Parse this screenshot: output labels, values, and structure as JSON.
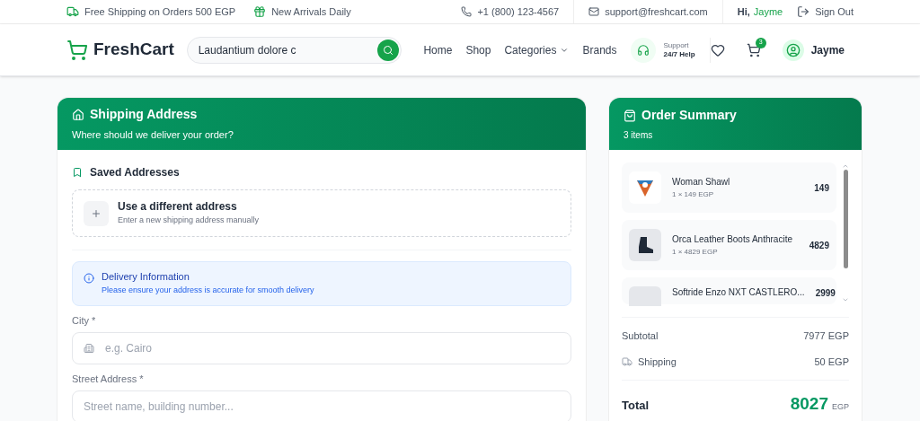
{
  "top_bar": {
    "promos": [
      {
        "kind": "shipping",
        "text": "Free Shipping on Orders 500 EGP"
      },
      {
        "kind": "gift",
        "text": "New Arrivals Daily"
      }
    ],
    "phone": "+1 (800) 123-4567",
    "email": "support@freshcart.com",
    "greeting": "Hi,",
    "user": "Jayme",
    "sign_out": "Sign Out"
  },
  "header": {
    "logo": "FreshCart",
    "search": {
      "value": "Laudantium dolore c"
    },
    "nav": [
      {
        "label": "Home",
        "dropdown": false
      },
      {
        "label": "Shop",
        "dropdown": false
      },
      {
        "label": "Categories",
        "dropdown": true
      },
      {
        "label": "Brands",
        "dropdown": false
      }
    ],
    "support": {
      "label": "Support",
      "value": "24/7 Help"
    },
    "cart_count": "3",
    "account": "Jayme"
  },
  "shipping": {
    "title": "Shipping Address",
    "subtitle": "Where should we deliver your order?",
    "saved_title": "Saved Addresses",
    "new_address": {
      "title": "Use a different address",
      "subtitle": "Enter a new shipping address manually"
    },
    "info": {
      "title": "Delivery Information",
      "text": "Please ensure your address is accurate for smooth delivery"
    },
    "fields": [
      {
        "label": "City *",
        "placeholder": "e.g. Cairo",
        "icon": true
      },
      {
        "label": "Street Address *",
        "placeholder": "Street name, building number..."
      }
    ]
  },
  "summary": {
    "title": "Order Summary",
    "count": "3 items",
    "items": [
      {
        "kind": "shawl",
        "name": "Woman Shawl",
        "qty": "1 × 149 EGP",
        "price": "149"
      },
      {
        "kind": "boots",
        "name": "Orca Leather Boots Anthracite",
        "qty": "1 × 4829 EGP",
        "price": "4829"
      },
      {
        "kind": "blank",
        "name": "Softride Enzo NXT CASTLERO...",
        "price": "2999"
      }
    ],
    "subtotal": {
      "label": "Subtotal",
      "value": "7977 EGP"
    },
    "shipping": {
      "label": "Shipping",
      "value": "50 EGP"
    },
    "total": {
      "label": "Total",
      "value": "8027",
      "currency": "EGP"
    }
  }
}
